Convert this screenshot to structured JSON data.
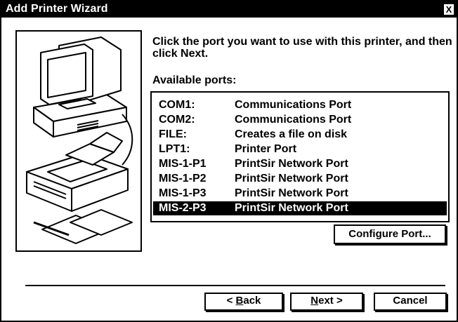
{
  "window": {
    "title": "Add Printer Wizard",
    "close_label": "X"
  },
  "instruction": "Click the port you want to use with this printer, and then click Next.",
  "ports_label": "Available ports:",
  "ports": [
    {
      "name": "COM1:",
      "description": "Communications Port",
      "selected": false
    },
    {
      "name": "COM2:",
      "description": "Communications Port",
      "selected": false
    },
    {
      "name": "FILE:",
      "description": "Creates a file on disk",
      "selected": false
    },
    {
      "name": "LPT1:",
      "description": "Printer Port",
      "selected": false
    },
    {
      "name": "MIS-1-P1",
      "description": "PrintSir Network Port",
      "selected": false
    },
    {
      "name": "MIS-1-P2",
      "description": "PrintSir Network Port",
      "selected": false
    },
    {
      "name": "MIS-1-P3",
      "description": "PrintSir Network Port",
      "selected": false
    },
    {
      "name": "MIS-2-P3",
      "description": "PrintSir Network Port",
      "selected": true
    }
  ],
  "buttons": {
    "configure_port": "Configure Port...",
    "back_prefix": "< ",
    "back_mnemonic": "B",
    "back_rest": "ack",
    "next_mnemonic": "N",
    "next_rest": "ext >",
    "cancel": "Cancel"
  },
  "illustration_icons": [
    "computer-icon",
    "printer-icon",
    "paper-sheets-icon"
  ]
}
